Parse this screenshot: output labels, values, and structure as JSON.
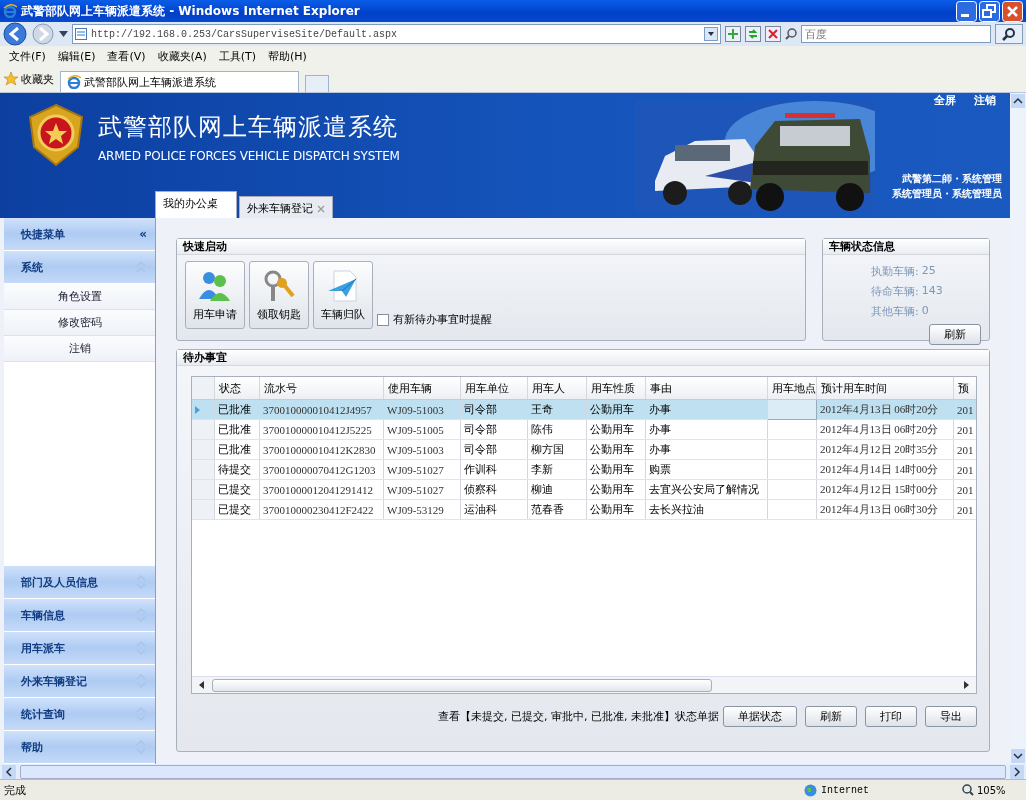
{
  "window": {
    "title": "武警部队网上车辆派遣系统 - Windows Internet Explorer"
  },
  "address_bar": {
    "url": "http://192.168.0.253/CarsSuperviseSite/Default.aspx",
    "search_placeholder": "百度"
  },
  "menu": [
    "文件(F)",
    "编辑(E)",
    "查看(V)",
    "收藏夹(A)",
    "工具(T)",
    "帮助(H)"
  ],
  "favorites": {
    "label": "收藏夹",
    "tabs": [
      {
        "label": "武警部队网上车辆派遣系统",
        "selected": true
      }
    ]
  },
  "header": {
    "title": "武警部队网上车辆派遣系统",
    "subtitle": "ARMED POLICE FORCES VEHICLE DISPATCH SYSTEM",
    "links": [
      "全屏",
      "注销"
    ],
    "user_lines": [
      "武警第二師・系统管理",
      "系统管理员・系统管理员"
    ]
  },
  "page_tabs": [
    {
      "label": "我的办公桌",
      "selected": true,
      "closable": false
    },
    {
      "label": "外来车辆登记",
      "selected": false,
      "closable": true
    }
  ],
  "sidebar": {
    "title": "快捷菜单",
    "collapse": "«",
    "groups": [
      {
        "label": "系统",
        "expanded": true,
        "items": [
          "角色设置",
          "修改密码",
          "注销"
        ]
      },
      {
        "label": "部门及人员信息",
        "expanded": false
      },
      {
        "label": "车辆信息",
        "expanded": false
      },
      {
        "label": "用车派车",
        "expanded": false
      },
      {
        "label": "外来车辆登记",
        "expanded": false
      },
      {
        "label": "统计查询",
        "expanded": false
      },
      {
        "label": "帮助",
        "expanded": false
      }
    ]
  },
  "quick_start": {
    "title": "快速启动",
    "buttons": [
      {
        "label": "用车申请",
        "kind": "users"
      },
      {
        "label": "领取钥匙",
        "kind": "key"
      },
      {
        "label": "车辆归队",
        "kind": "plane"
      }
    ],
    "reminder": {
      "label": "有新待办事宜时提醒",
      "checked": false
    }
  },
  "vehicle_status": {
    "title": "车辆状态信息",
    "lines": [
      {
        "label": "执勤车辆:",
        "value": "25"
      },
      {
        "label": "待命车辆:",
        "value": "143"
      },
      {
        "label": "其他车辆:",
        "value": "0"
      }
    ],
    "button": "刷新"
  },
  "todo": {
    "title": "待办事宜",
    "table": {
      "columns": [
        "状态",
        "流水号",
        "使用车辆",
        "用车单位",
        "用车人",
        "用车性质",
        "事由",
        "用车地点",
        "预计用车时间",
        "预"
      ],
      "rows": [
        {
          "selected": true,
          "cells": [
            "已批准",
            "370010000010412J4957",
            "WJ09-51003",
            "司令部",
            "王奇",
            "公勤用车",
            "办事",
            "",
            "2012年4月13日 06时20分",
            "201"
          ]
        },
        {
          "selected": false,
          "cells": [
            "已批准",
            "370010000010412J5225",
            "WJ09-51005",
            "司令部",
            "陈伟",
            "公勤用车",
            "办事",
            "",
            "2012年4月13日 06时20分",
            "201"
          ]
        },
        {
          "selected": false,
          "cells": [
            "已批准",
            "370010000010412K2830",
            "WJ09-51003",
            "司令部",
            "柳方国",
            "公勤用车",
            "办事",
            "",
            "2012年4月12日 20时35分",
            "201"
          ]
        },
        {
          "selected": false,
          "cells": [
            "待提交",
            "370010000070412G1203",
            "WJ09-51027",
            "作训科",
            "李新",
            "公勤用车",
            "购票",
            "",
            "2012年4月14日 14时00分",
            "201"
          ]
        },
        {
          "selected": false,
          "cells": [
            "已提交",
            "37001000012041291412",
            "WJ09-51027",
            "侦察科",
            "柳迪",
            "公勤用车",
            "去宜兴公安局了解情况",
            "",
            "2012年4月12日 15时00分",
            "201"
          ]
        },
        {
          "selected": false,
          "cells": [
            "已提交",
            "370010000230412F2422",
            "WJ09-53129",
            "运油科",
            "范春香",
            "公勤用车",
            "去长兴拉油",
            "",
            "2012年4月13日 06时30分",
            "201"
          ]
        }
      ]
    },
    "footer_note": "查看【未提交, 已提交, 审批中, 已批准, 未批准】状态单据",
    "buttons": [
      "单据状态",
      "刷新",
      "打印",
      "导出"
    ]
  },
  "status_bar": {
    "text": "完成",
    "zone": "Internet",
    "zoom": "105%"
  }
}
